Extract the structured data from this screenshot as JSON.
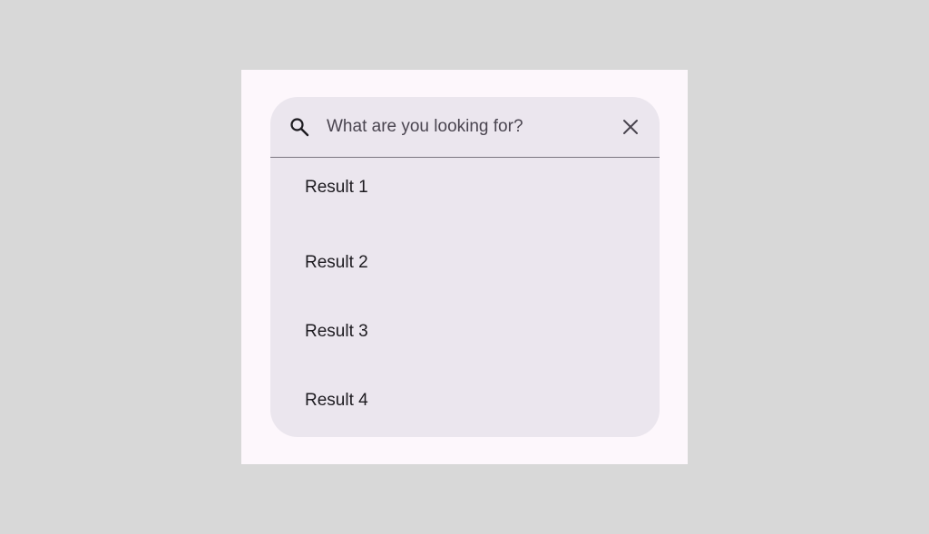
{
  "search": {
    "placeholder": "What are you looking for?",
    "value": ""
  },
  "results": [
    {
      "label": "Result 1"
    },
    {
      "label": "Result 2"
    },
    {
      "label": "Result 3"
    },
    {
      "label": "Result 4"
    }
  ],
  "icons": {
    "leading": "search-icon",
    "trailing": "close-icon"
  },
  "colors": {
    "background": "#d8d8d8",
    "surface": "#fdf7fc",
    "search_container": "#ebe6ee",
    "divider": "#7a757f",
    "text": "#1d1b20"
  }
}
